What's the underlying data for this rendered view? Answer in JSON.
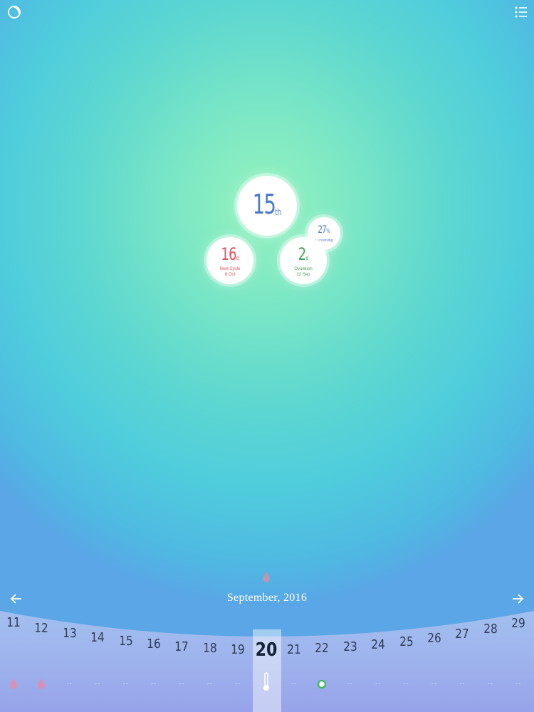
{
  "header": {
    "app_icon": "moon-icon",
    "menu_icon": "list-icon"
  },
  "summary": {
    "cycle_day": "15",
    "cycle_day_suffix": "th",
    "next_cycle_value": "16",
    "next_cycle_unit": "d",
    "next_cycle_label": "Next Cycle",
    "next_cycle_date": "6 Oct",
    "ovulation_value": "2",
    "ovulation_unit": "d",
    "ovulation_label": "Ovulation",
    "ovulation_date": "22 Sep",
    "conceiving_value": "27",
    "conceiving_unit": "%",
    "conceiving_label": "Conceiving"
  },
  "calendar": {
    "month": "September, 2016",
    "prev_icon": "arrow-left-icon",
    "next_icon": "arrow-right-icon",
    "today": "20",
    "days": [
      "11",
      "12",
      "13",
      "14",
      "15",
      "16",
      "17",
      "18",
      "19",
      "20",
      "21",
      "22",
      "23",
      "24",
      "25",
      "26",
      "27",
      "28",
      "29"
    ],
    "marks": [
      "drop",
      "drop",
      "--",
      "--",
      "--",
      "--",
      "--",
      "--",
      "--",
      "thermometer",
      "--",
      "circle",
      "--",
      "--",
      "--",
      "--",
      "--",
      "--",
      "--"
    ]
  },
  "colors": {
    "accent_blue": "#4a7ad0",
    "period_red": "#e0515c",
    "ovulation_green": "#44a25f"
  }
}
